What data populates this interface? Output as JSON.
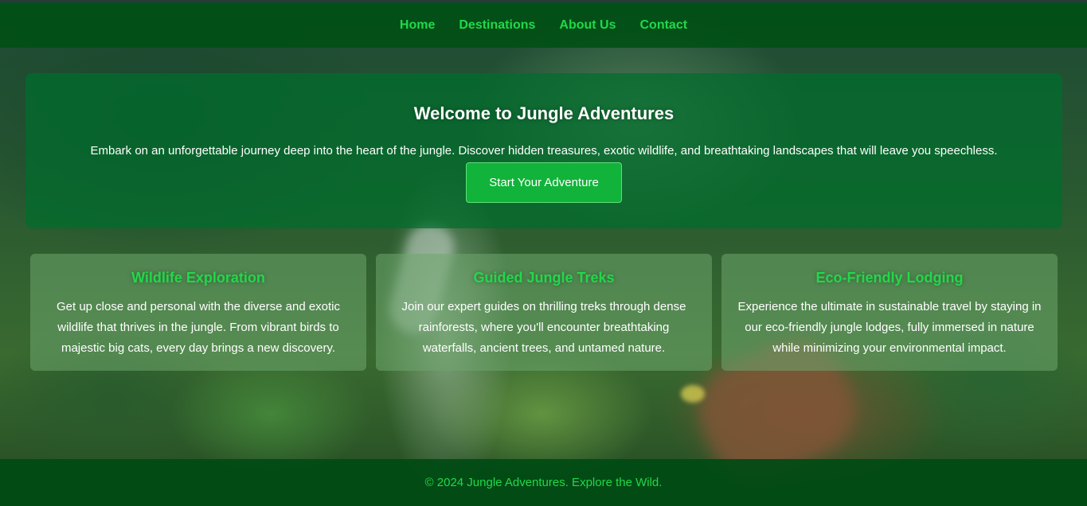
{
  "nav": {
    "items": [
      {
        "label": "Home"
      },
      {
        "label": "Destinations"
      },
      {
        "label": "About Us"
      },
      {
        "label": "Contact"
      }
    ]
  },
  "hero": {
    "title": "Welcome to Jungle Adventures",
    "text": "Embark on an unforgettable journey deep into the heart of the jungle. Discover hidden treasures, exotic wildlife, and breathtaking landscapes that will leave you speechless.",
    "cta_label": "Start Your Adventure"
  },
  "features": [
    {
      "title": "Wildlife Exploration",
      "text": "Get up close and personal with the diverse and exotic wildlife that thrives in the jungle. From vibrant birds to majestic big cats, every day brings a new discovery."
    },
    {
      "title": "Guided Jungle Treks",
      "text": "Join our expert guides on thrilling treks through dense rainforests, where you'll encounter breathtaking waterfalls, ancient trees, and untamed nature."
    },
    {
      "title": "Eco-Friendly Lodging",
      "text": "Experience the ultimate in sustainable travel by staying in our eco-friendly jungle lodges, fully immersed in nature while minimizing your environmental impact."
    }
  ],
  "footer": {
    "text": "© 2024 Jungle Adventures. Explore the Wild."
  },
  "colors": {
    "accent": "#22d84a",
    "nav_bg": "#005014",
    "hero_bg": "#006e2d",
    "button_bg": "#11b33a"
  }
}
